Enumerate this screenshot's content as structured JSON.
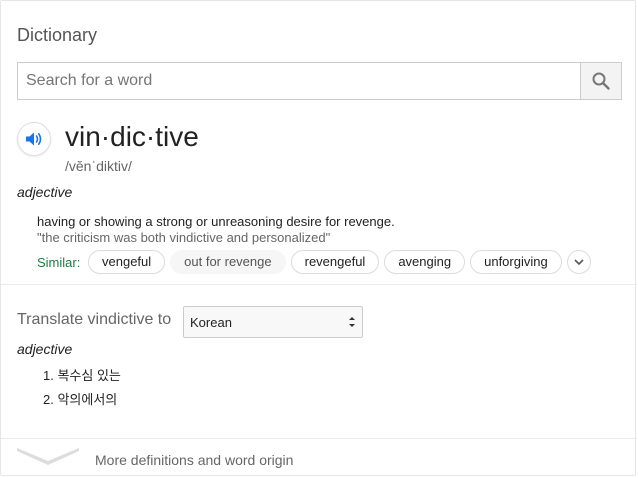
{
  "header": {
    "title": "Dictionary"
  },
  "search": {
    "placeholder": "Search for a word",
    "value": "",
    "button_icon": "search-icon"
  },
  "entry": {
    "word": "vin·dic·tive",
    "phonetic": "/vĕnˈdiktiv/",
    "speaker_icon": "speaker-icon",
    "part_of_speech": "adjective",
    "definition": "having or showing a strong or unreasoning desire for revenge.",
    "example": "\"the criticism was both vindictive and personalized\"",
    "similar_label": "Similar:",
    "similar": [
      "vengeful",
      "out for revenge",
      "revengeful",
      "avenging",
      "unforgiving"
    ]
  },
  "translate": {
    "label": "Translate vindictive to",
    "language": "Korean",
    "part_of_speech": "adjective",
    "items": [
      "1. 복수심 있는",
      "2. 악의에서의"
    ]
  },
  "footer": {
    "more_label": "More definitions and word origin"
  },
  "colors": {
    "accent_blue": "#1a73e8",
    "similar_green": "#1a7d43"
  }
}
